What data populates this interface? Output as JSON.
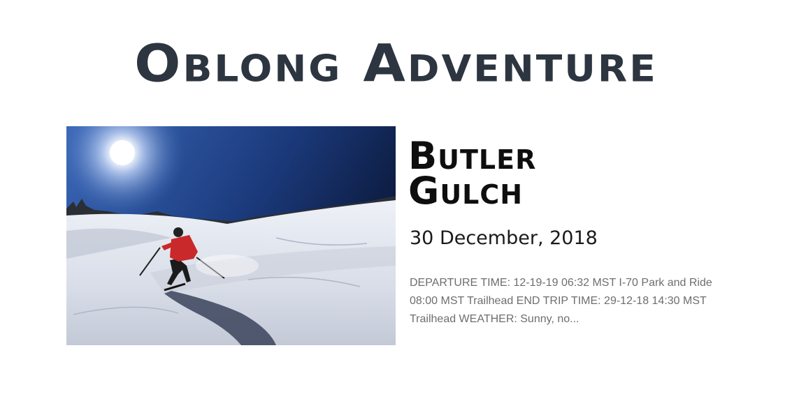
{
  "site": {
    "title": "Oblong Adventure"
  },
  "post": {
    "title": "Butler Gulch",
    "date": "30 December, 2018",
    "excerpt": "DEPARTURE TIME: 12-19-19 06:32 MST I-70 Park and Ride 08:00 MST Trailhead END TRIP TIME: 29-12-18 14:30 MST Trailhead WEATHER: Sunny, no...",
    "image_subject": "skier descending a sunlit snowy slope"
  },
  "colors": {
    "title": "#2c3540",
    "post_title": "#0e0e0e",
    "excerpt": "#6e6e6e",
    "sky_dark": "#0c1a3d",
    "sky_light": "#3b68b8"
  }
}
